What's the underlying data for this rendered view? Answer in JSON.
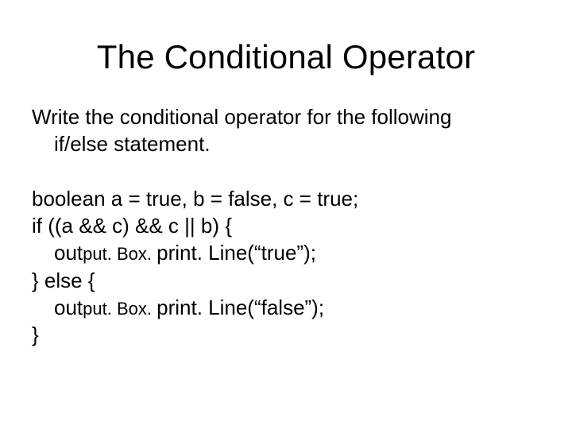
{
  "title": "The Conditional Operator",
  "instruction_line1": "Write the conditional operator for the following",
  "instruction_line2": "if/else statement.",
  "code": {
    "l1": "boolean a = true, b = false, c = true;",
    "l2": "if ((a && c) && c || b) {",
    "l3a": "out",
    "l3b": "put. Box. ",
    "l3c": "print. Line(“true”);",
    "l4": "} else {",
    "l5a": "out",
    "l5b": "put. Box. ",
    "l5c": "print. Line(“false”);",
    "l6": "}"
  }
}
